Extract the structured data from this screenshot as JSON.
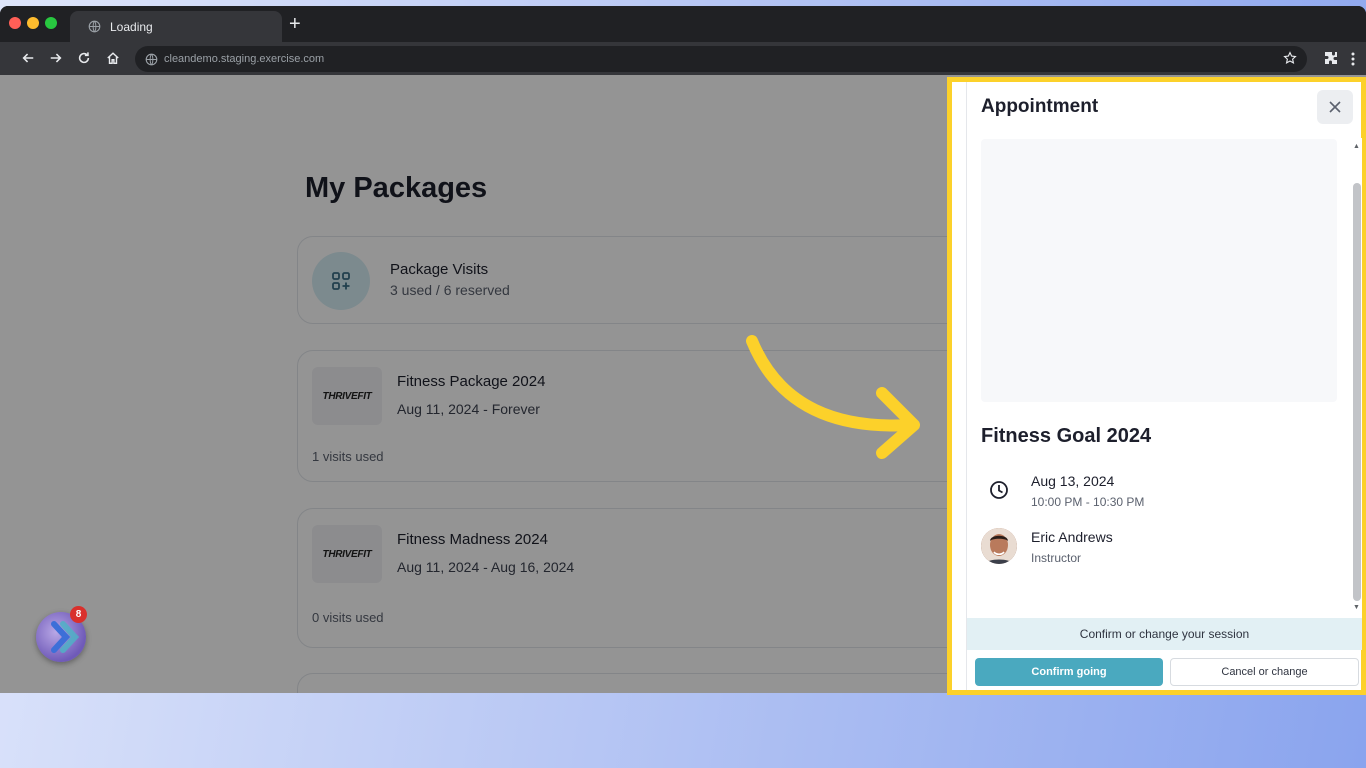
{
  "browser": {
    "tab_title": "Loading",
    "url": "cleandemo.staging.exercise.com",
    "new_tab_symbol": "+"
  },
  "page": {
    "title": "My Packages",
    "visits_card": {
      "title": "Package Visits",
      "subtitle": "3 used / 6 reserved"
    },
    "packages": [
      {
        "logo": "THRIVEFIT",
        "title": "Fitness Package 2024",
        "dates": "Aug 11, 2024 - Forever",
        "visits": "1 visits used"
      },
      {
        "logo": "THRIVEFIT",
        "title": "Fitness Madness 2024",
        "dates": "Aug 11, 2024 - Aug 16, 2024",
        "visits": "0 visits used"
      }
    ],
    "notification_count": "8"
  },
  "panel": {
    "title": "Appointment",
    "class_title": "Fitness Goal 2024",
    "date": "Aug 13, 2024",
    "time": "10:00 PM - 10:30 PM",
    "instructor_name": "Eric Andrews",
    "instructor_role": "Instructor",
    "confirm_prompt": "Confirm or change your session",
    "confirm_button": "Confirm going",
    "cancel_button": "Cancel or change"
  },
  "colors": {
    "highlight": "#fcd12a",
    "accent": "#4aa9bf",
    "arrow": "#fcd12a"
  },
  "icons": [
    "globe-icon",
    "back-icon",
    "forward-icon",
    "reload-icon",
    "home-icon",
    "star-icon",
    "extensions-icon",
    "kebab-icon",
    "grid-plus-icon",
    "close-icon",
    "clock-icon",
    "curved-arrow-icon"
  ]
}
